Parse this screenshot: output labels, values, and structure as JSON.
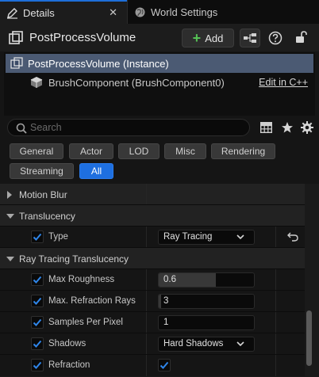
{
  "tabs": [
    {
      "label": "Details",
      "icon": "pencil-icon",
      "active": true
    },
    {
      "label": "World Settings",
      "icon": "globe-icon",
      "active": false
    }
  ],
  "header": {
    "title": "PostProcessVolume",
    "add_label": "Add"
  },
  "tree": {
    "root": "PostProcessVolume (Instance)",
    "child": "BrushComponent (BrushComponent0)",
    "edit_link": "Edit in C++"
  },
  "search": {
    "placeholder": "Search"
  },
  "filters": [
    "General",
    "Actor",
    "LOD",
    "Misc",
    "Rendering",
    "Streaming",
    "All"
  ],
  "active_filter": "All",
  "properties": {
    "motion_blur": "Motion Blur",
    "translucency": "Translucency",
    "type_label": "Type",
    "type_value": "Ray Tracing",
    "rt_translucency": "Ray Tracing Translucency",
    "max_roughness_label": "Max Roughness",
    "max_roughness_value": "0.6",
    "max_roughness_fill": 0.6,
    "max_refraction_label": "Max. Refraction Rays",
    "max_refraction_value": "3",
    "samples_label": "Samples Per Pixel",
    "samples_value": "1",
    "shadows_label": "Shadows",
    "shadows_value": "Hard Shadows",
    "refraction_label": "Refraction",
    "refraction_checked": true
  },
  "colors": {
    "accent": "#1e6fe0",
    "selected_row": "#4b5a73",
    "add_plus": "#55c255"
  }
}
